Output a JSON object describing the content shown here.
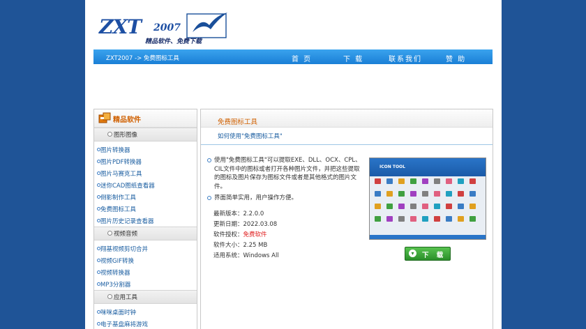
{
  "logo": {
    "main": "ZXT",
    "year": "2007",
    "slogan": "精品软件、免费下载"
  },
  "breadcrumb": "ZXT2007 -> 免费图标工具",
  "nav": [
    "首 页",
    "下 载",
    "联系我们",
    "赞 助"
  ],
  "sidebar": {
    "title": "精品软件",
    "categories": [
      {
        "label": "图形图像",
        "items": [
          "图片转换器",
          "图片PDF转换器",
          "图片马赛克工具",
          "迷你CAD图纸查看器",
          "倒影制作工具",
          "免费图标工具",
          "图片历史记录查看器"
        ]
      },
      {
        "label": "视频音频",
        "items": [
          "翔基视频剪切合并",
          "视频GIF转换",
          "视频转换器",
          "MP3分割器"
        ]
      },
      {
        "label": "应用工具",
        "items": [
          "咪咪桌面时钟",
          "电子基盘麻将游戏"
        ]
      }
    ]
  },
  "main": {
    "title": "免费图标工具",
    "subtitle": "如何使用\"免费图标工具\"",
    "description": [
      "使用\"免费图标工具\"可以提取EXE、DLL、OCX、CPL、CIL文件中的图标或者打开各种图片文件，并把这些提取的图标及图片保存为图标文件或者是其他格式的图片文件。",
      "界面简单实用，用户操作方便。"
    ],
    "info": {
      "version_label": "最新版本：",
      "version": "2.2.0.0",
      "date_label": "更新日期：",
      "date": "2022.03.08",
      "license_label": "软件授权：",
      "license": "免费软件",
      "size_label": "软件大小：",
      "size": "2.25 MB",
      "os_label": "适用系统：",
      "os": "Windows All"
    },
    "screenshot_title": "ICON TOOL",
    "download_label": "下 载"
  },
  "colors": {
    "page_bg": "#1f5497",
    "nav_bar": "#2a8ee0",
    "accent_orange": "#d06000",
    "link_blue": "#1a5da0",
    "license_red": "#e02020",
    "download_green": "#3aa83a"
  }
}
